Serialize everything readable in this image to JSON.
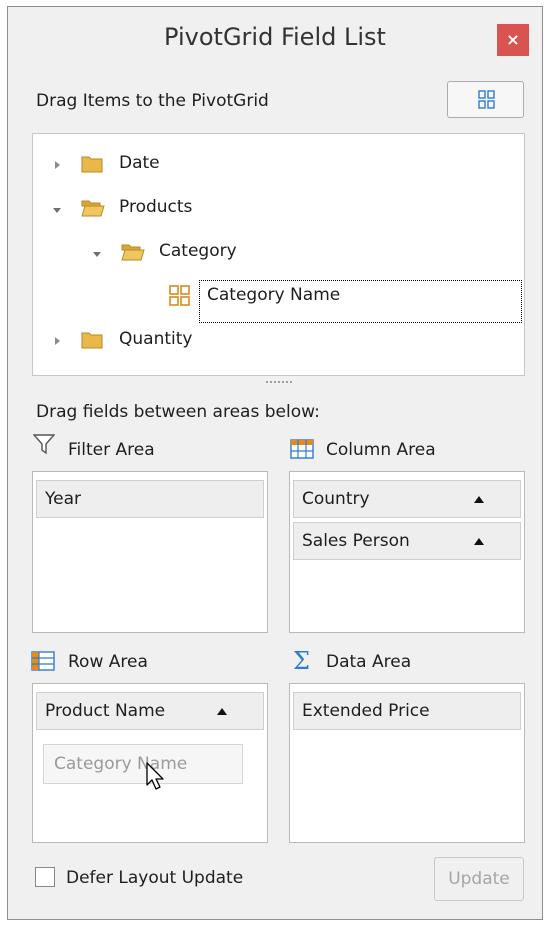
{
  "window": {
    "title": "PivotGrid Field List",
    "close_glyph": "×"
  },
  "top": {
    "drag_items_label": "Drag Items to the PivotGrid",
    "layout_button_icon": "layout-grid-icon"
  },
  "tree": {
    "nodes": [
      {
        "label": "Date",
        "icon": "folder-icon",
        "expanded": false
      },
      {
        "label": "Products",
        "icon": "folder-open-icon",
        "expanded": true
      },
      {
        "label": "Category",
        "icon": "folder-open-icon",
        "expanded": true
      },
      {
        "label": "Category Name",
        "icon": "field-icon",
        "selected": true
      },
      {
        "label": "Quantity",
        "icon": "folder-icon",
        "expanded": false
      }
    ]
  },
  "areas_label": "Drag fields between areas below:",
  "filter_area": {
    "label": "Filter Area",
    "icon": "filter-icon",
    "fields": [
      "Year"
    ]
  },
  "column_area": {
    "label": "Column Area",
    "icon": "column-area-icon",
    "fields": [
      "Country",
      "Sales Person"
    ]
  },
  "row_area": {
    "label": "Row Area",
    "icon": "row-area-icon",
    "fields": [
      "Product Name"
    ],
    "drag_preview": "Category Name"
  },
  "data_area": {
    "label": "Data Area",
    "icon": "sigma-icon",
    "fields": [
      "Extended Price"
    ]
  },
  "footer": {
    "defer_label": "Defer Layout Update",
    "defer_checked": false,
    "update_label": "Update"
  },
  "colors": {
    "close_button": "#d9534f",
    "folder": "#e8b84a",
    "accent_blue": "#2e7bcf"
  }
}
